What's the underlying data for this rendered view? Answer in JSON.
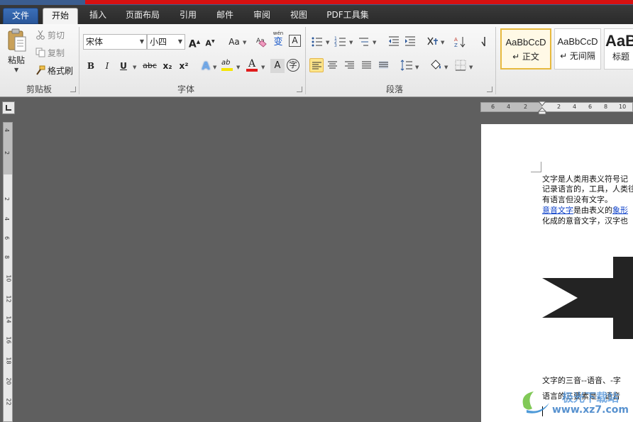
{
  "tabs": {
    "file": "文件",
    "items": [
      "开始",
      "插入",
      "页面布局",
      "引用",
      "邮件",
      "审阅",
      "视图",
      "PDF工具集"
    ]
  },
  "clipboard": {
    "paste": "粘贴",
    "cut": "剪切",
    "copy": "复制",
    "format_painter": "格式刷",
    "group_label": "剪贴板"
  },
  "font": {
    "font_name": "宋体",
    "font_size": "小四",
    "group_label": "字体",
    "grow": "A",
    "shrink": "A",
    "change_case": "Aa",
    "clear_format_glyph": "A",
    "bold": "B",
    "italic": "I",
    "underline": "U",
    "strike": "abc",
    "subscript": "x₂",
    "superscript": "x²",
    "font_color": "A",
    "highlight": "ab",
    "char_shading": "A",
    "enclose_char": "字",
    "pinyin_top": "wén",
    "pinyin_char": "变"
  },
  "paragraph": {
    "group_label": "段落"
  },
  "styles": {
    "items": [
      {
        "sample": "AaBbCcD",
        "name": "↵ 正文"
      },
      {
        "sample": "AaBbCcD",
        "name": "↵ 无间隔"
      },
      {
        "sample": "AaB",
        "name": "标题"
      }
    ]
  },
  "rulers": {
    "horizontal": [
      "6",
      "4",
      "2",
      "2",
      "4",
      "6",
      "8",
      "10"
    ],
    "vertical": [
      "4",
      "2",
      "2",
      "4",
      "6",
      "8",
      "10",
      "12",
      "14",
      "16",
      "18",
      "20",
      "22"
    ]
  },
  "document": {
    "lines": [
      "文字是人类用表义符号记",
      "记录语言的，工具，人类往",
      "有语言但没有文字。"
    ],
    "link1": "意音文字",
    "mid1": "是由表义的",
    "link2": "象形",
    "line5": "化成的意音文字，汉字也",
    "line6": "文字的三音--语音、-字 ",
    "line7": "语言的三要素是，语音"
  },
  "watermark": {
    "text": "极光下载站",
    "url": "www.xz7.com"
  },
  "colors": {
    "accent": "#2a579a",
    "font_color_bar": "#e01b1b",
    "highlight_bar": "#f5e500",
    "selected": "#fde58b"
  }
}
